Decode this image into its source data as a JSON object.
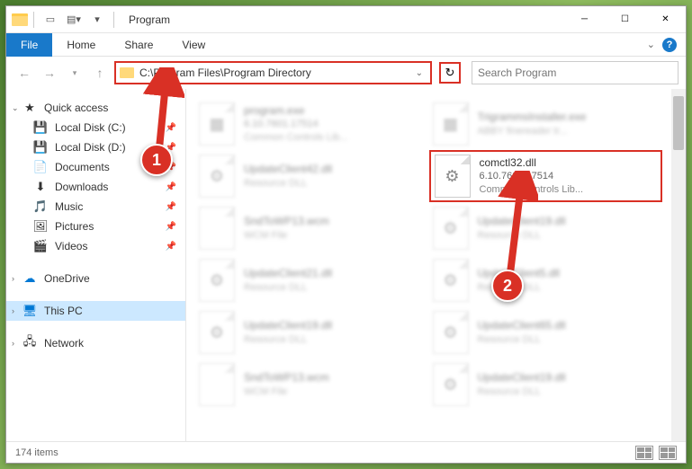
{
  "window": {
    "title": "Program"
  },
  "ribbon": {
    "file": "File",
    "tabs": [
      "Home",
      "Share",
      "View"
    ]
  },
  "address": {
    "path": "C:\\Program Files\\Program Directory"
  },
  "search": {
    "placeholder": "Search Program"
  },
  "sidebar": {
    "quick": {
      "label": "Quick access"
    },
    "items": [
      {
        "label": "Local Disk (C:)",
        "icon": "💾",
        "pin": true
      },
      {
        "label": "Local Disk (D:)",
        "icon": "💾",
        "pin": true
      },
      {
        "label": "Documents",
        "icon": "📄",
        "pin": true
      },
      {
        "label": "Downloads",
        "icon": "⬇",
        "pin": true
      },
      {
        "label": "Music",
        "icon": "🎵",
        "pin": true
      },
      {
        "label": "Pictures",
        "icon": "🖼",
        "pin": true
      },
      {
        "label": "Videos",
        "icon": "🎬",
        "pin": true
      }
    ],
    "onedrive": {
      "label": "OneDrive",
      "icon": "☁"
    },
    "thispc": {
      "label": "This PC",
      "icon": "🖥"
    },
    "network": {
      "label": "Network",
      "icon": "🖧"
    }
  },
  "files": [
    {
      "name": "program.exe",
      "ver": "6.10.7601.17514",
      "desc": "Common Controls Lib...",
      "icon": "▦"
    },
    {
      "name": "TrigrammsInstaller.exe",
      "ver": "",
      "desc": "ABBY finereader tr...",
      "icon": "▦"
    },
    {
      "name": "UpdateClient42.dll",
      "ver": "",
      "desc": "Resource DLL",
      "icon": "⚙"
    },
    {
      "name": "comctl32.dll",
      "ver": "6.10.7601.17514",
      "desc": "Common Controls Lib...",
      "icon": "⚙"
    },
    {
      "name": "SndToWP13.wcm",
      "ver": "",
      "desc": "WCM File",
      "icon": ""
    },
    {
      "name": "UpdateClient19.dll",
      "ver": "",
      "desc": "Resource DLL",
      "icon": "⚙"
    },
    {
      "name": "UpdateClient21.dll",
      "ver": "",
      "desc": "Resource DLL",
      "icon": "⚙"
    },
    {
      "name": "UpdateClient5.dll",
      "ver": "",
      "desc": "Resource DLL",
      "icon": "⚙"
    },
    {
      "name": "UpdateClient19.dll",
      "ver": "",
      "desc": "Resource DLL",
      "icon": "⚙"
    },
    {
      "name": "UpdateClient65.dll",
      "ver": "",
      "desc": "Resource DLL",
      "icon": "⚙"
    },
    {
      "name": "SndToWP13.wcm",
      "ver": "",
      "desc": "WCM File",
      "icon": ""
    },
    {
      "name": "UpdateClient19.dll",
      "ver": "",
      "desc": "Resource DLL",
      "icon": "⚙"
    }
  ],
  "highlighted_index": 3,
  "status": {
    "count": "174 items"
  },
  "callouts": {
    "c1": "1",
    "c2": "2"
  }
}
